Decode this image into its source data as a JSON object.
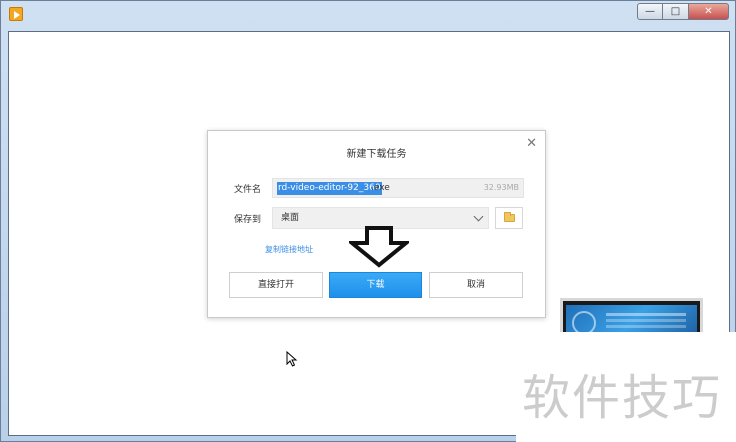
{
  "window": {
    "controls": {
      "minimize": "—",
      "maximize": "□",
      "close": "✕"
    }
  },
  "dialog": {
    "title": "新建下载任务",
    "close_glyph": "✕",
    "filename_label": "文件名",
    "filename_selected": "rd-video-editor-92_360",
    "filename_rest": ".exe",
    "filesize": "32.93MB",
    "save_to_label": "保存到",
    "save_to_value": "桌面",
    "copy_link": "复制链接地址",
    "buttons": {
      "open": "直接打开",
      "download": "下载",
      "cancel": "取消"
    }
  },
  "watermark": "软件技巧",
  "colors": {
    "accent": "#1e90ea",
    "selection": "#3a8ee6",
    "link": "#3a8ee6"
  },
  "icons": [
    "app-icon",
    "close-icon",
    "chevron-down-icon",
    "folder-icon",
    "arrow-down-icon",
    "cursor-icon"
  ]
}
